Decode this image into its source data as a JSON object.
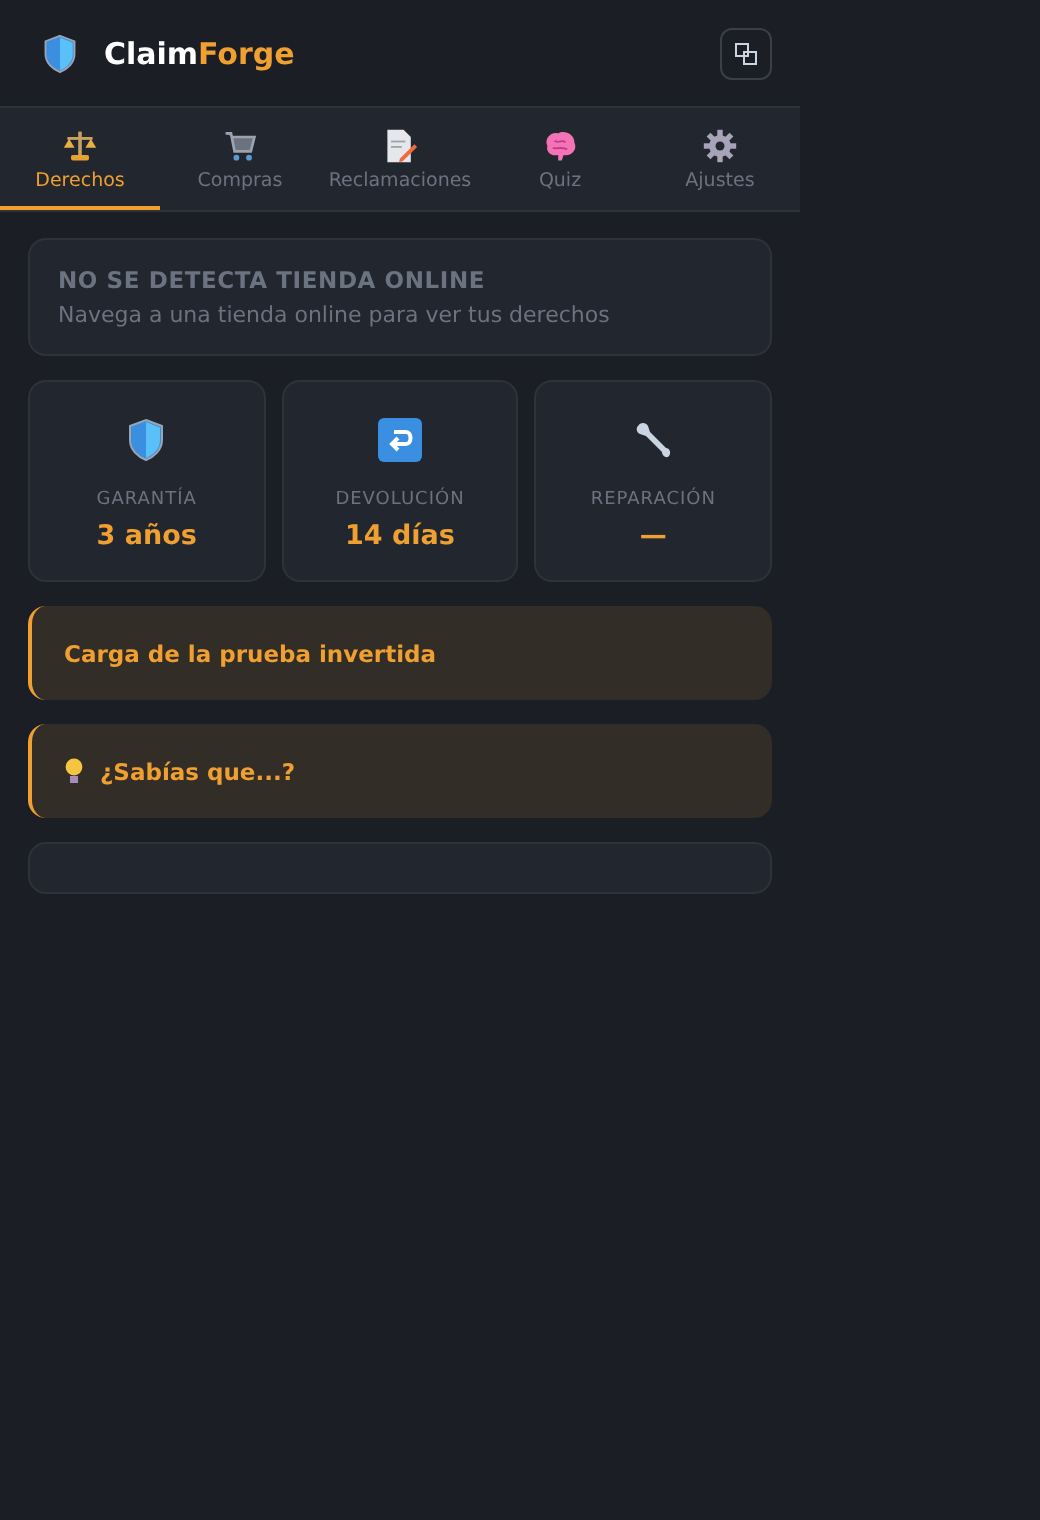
{
  "header": {
    "brand_main": "Claim",
    "brand_accent": "Forge"
  },
  "tabs": [
    {
      "label": "Derechos",
      "selected": true
    },
    {
      "label": "Compras",
      "selected": false
    },
    {
      "label": "Reclamaciones",
      "selected": false
    },
    {
      "label": "Quiz",
      "selected": false
    },
    {
      "label": "Ajustes",
      "selected": false
    }
  ],
  "notice": {
    "title": "NO SE DETECTA TIENDA ONLINE",
    "text": "Navega a una tienda online para ver tus derechos"
  },
  "stats": [
    {
      "label": "GARANTÍA",
      "value": "3 años"
    },
    {
      "label": "DEVOLUCIÓN",
      "value": "14 días"
    },
    {
      "label": "REPARACIÓN",
      "value": "—"
    }
  ],
  "callouts": [
    {
      "text": "Carga de la prueba invertida",
      "kind": "plain"
    },
    {
      "text": "¿Sabías que...?",
      "kind": "tip"
    }
  ]
}
